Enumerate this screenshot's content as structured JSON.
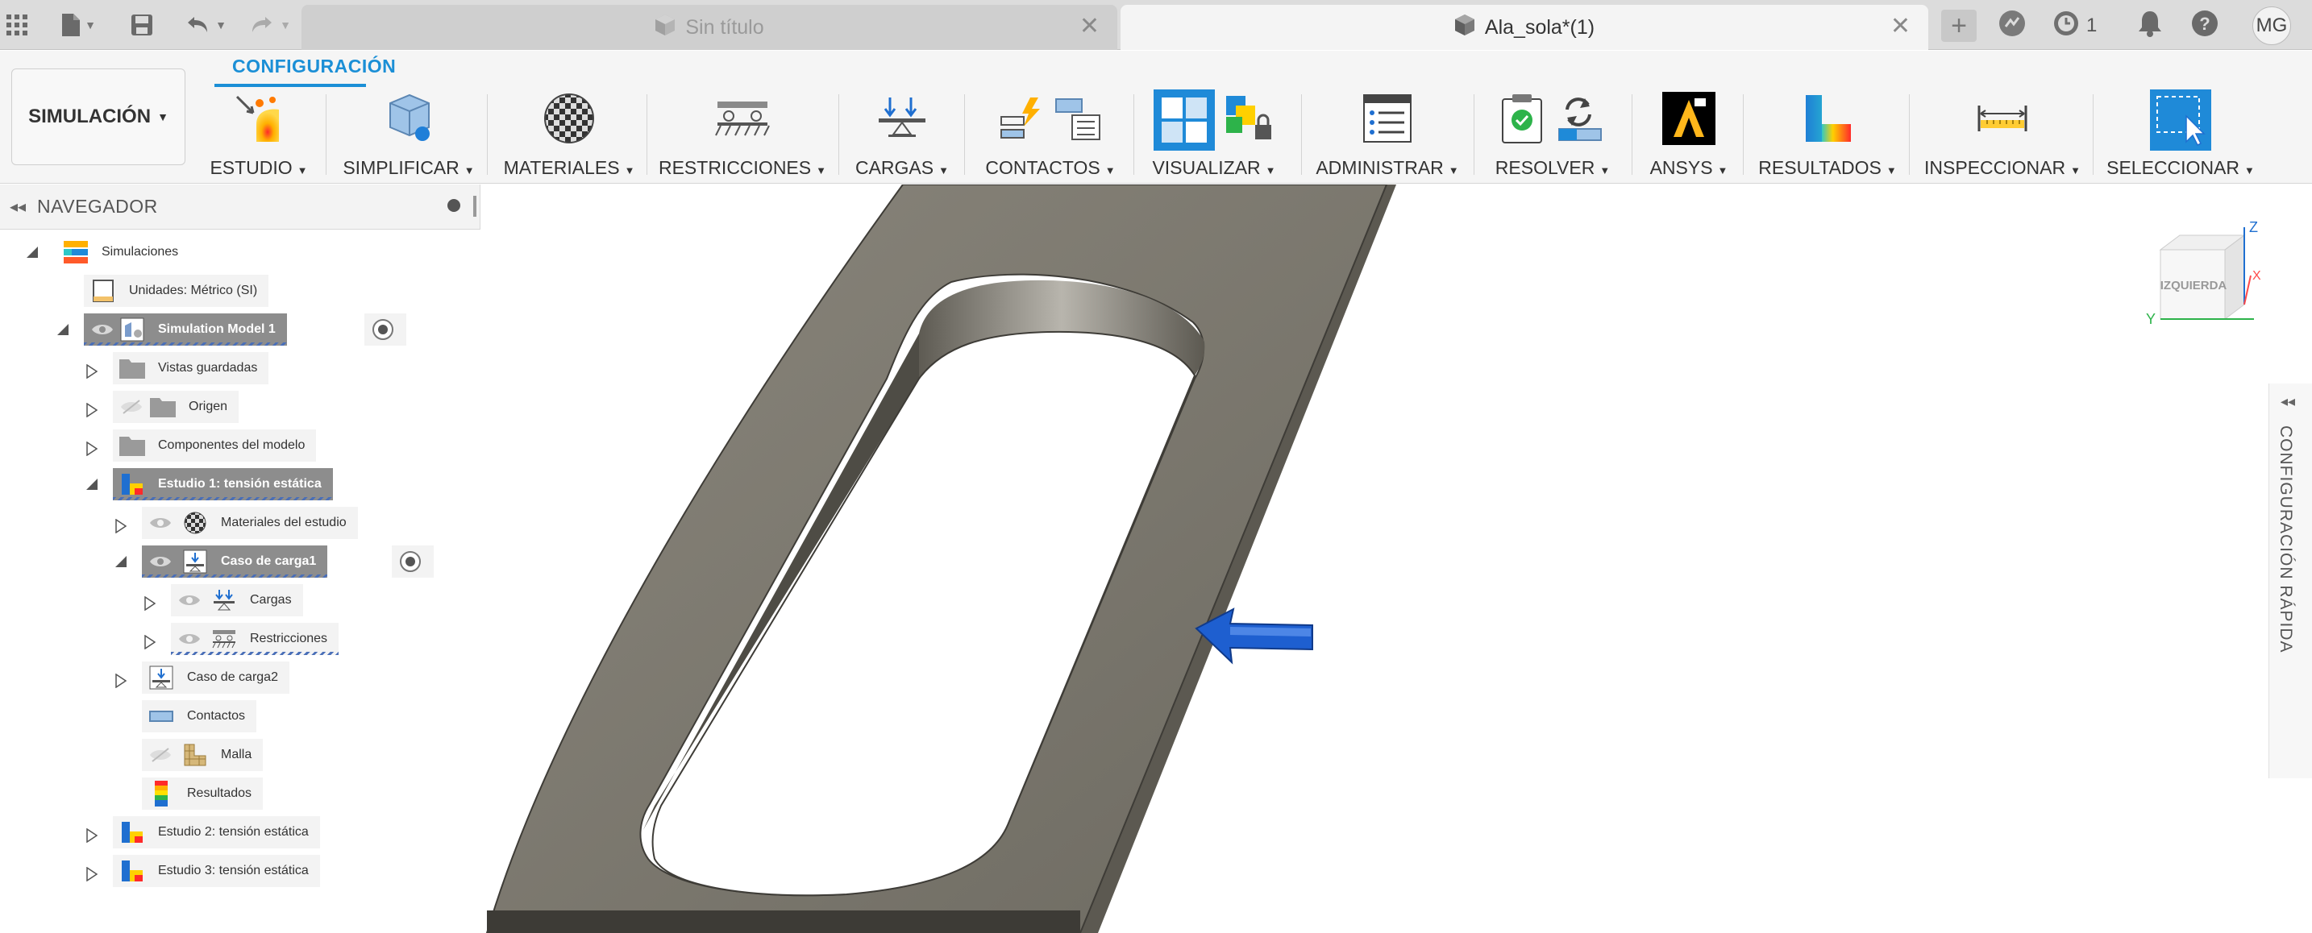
{
  "top_bar": {
    "tabs": [
      {
        "label": "Sin título",
        "active": false
      },
      {
        "label": "Ala_sola*(1)",
        "active": true
      }
    ],
    "job_count": "1",
    "user_initials": "MG",
    "icons": [
      "app-grid-icon",
      "file-icon",
      "save-icon",
      "undo-icon",
      "redo-icon",
      "new-tab-plus-icon",
      "extensions-icon",
      "job-status-icon",
      "notifications-icon",
      "help-icon"
    ]
  },
  "ribbon": {
    "active_tab": "CONFIGURACIÓN",
    "workspace": "SIMULACIÓN",
    "groups": [
      {
        "label": "ESTUDIO"
      },
      {
        "label": "SIMPLIFICAR"
      },
      {
        "label": "MATERIALES"
      },
      {
        "label": "RESTRICCIONES"
      },
      {
        "label": "CARGAS"
      },
      {
        "label": "CONTACTOS"
      },
      {
        "label": "VISUALIZAR"
      },
      {
        "label": "ADMINISTRAR"
      },
      {
        "label": "RESOLVER"
      },
      {
        "label": "ANSYS"
      },
      {
        "label": "RESULTADOS"
      },
      {
        "label": "INSPECCIONAR"
      },
      {
        "label": "SELECCIONAR"
      }
    ]
  },
  "browser": {
    "title": "NAVEGADOR",
    "tree": [
      {
        "label": "Simulaciones"
      },
      {
        "label": "Unidades: Métrico (SI)"
      },
      {
        "label": "Simulation Model 1"
      },
      {
        "label": "Vistas guardadas"
      },
      {
        "label": "Origen"
      },
      {
        "label": "Componentes del modelo"
      },
      {
        "label": "Estudio 1: tensión estática"
      },
      {
        "label": "Materiales del estudio"
      },
      {
        "label": "Caso de carga1"
      },
      {
        "label": "Cargas"
      },
      {
        "label": "Restricciones"
      },
      {
        "label": "Caso de carga2"
      },
      {
        "label": "Contactos"
      },
      {
        "label": "Malla"
      },
      {
        "label": "Resultados"
      },
      {
        "label": "Estudio 2: tensión estática"
      },
      {
        "label": "Estudio 3: tensión estática"
      }
    ]
  },
  "viewcube": {
    "face": "IZQUIERDA",
    "axis_z": "Z",
    "axis_y": "Y",
    "axis_x": "X"
  },
  "quick_panel": {
    "label": "CONFIGURACIÓN RÁPIDA"
  },
  "colors": {
    "accent": "#1b8fd6",
    "part_top": "#7a766c",
    "part_side": "#5d5a52",
    "load_arrow": "#1e5fd0"
  }
}
